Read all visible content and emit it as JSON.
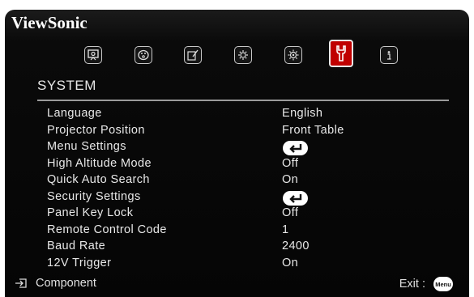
{
  "brand": "ViewSonic",
  "tabs": [
    {
      "icon": "display-icon",
      "active": false
    },
    {
      "icon": "palette-icon",
      "active": false
    },
    {
      "icon": "source-icon",
      "active": false
    },
    {
      "icon": "settings-basic-icon",
      "active": false
    },
    {
      "icon": "settings-advanced-icon",
      "active": false
    },
    {
      "icon": "wrench-icon",
      "active": true
    },
    {
      "icon": "info-icon",
      "active": false
    }
  ],
  "section_title": "SYSTEM",
  "menu": [
    {
      "label": "Language",
      "value": "English"
    },
    {
      "label": "Projector Position",
      "value": "Front Table"
    },
    {
      "label": "Menu Settings",
      "value": null,
      "enter": true
    },
    {
      "label": "High Altitude Mode",
      "value": "Off"
    },
    {
      "label": "Quick Auto Search",
      "value": "On"
    },
    {
      "label": "Security Settings",
      "value": null,
      "enter": true
    },
    {
      "label": "Panel Key Lock",
      "value": "Off"
    },
    {
      "label": "Remote Control Code",
      "value": "1"
    },
    {
      "label": "Baud Rate",
      "value": "2400"
    },
    {
      "label": "12V Trigger",
      "value": "On"
    }
  ],
  "footer": {
    "source_label": "Component",
    "exit_label": "Exit :",
    "menu_button_label": "Menu"
  },
  "colors": {
    "accent": "#c00000",
    "background": "#0a0a0a",
    "text": "#e8e8e8"
  }
}
